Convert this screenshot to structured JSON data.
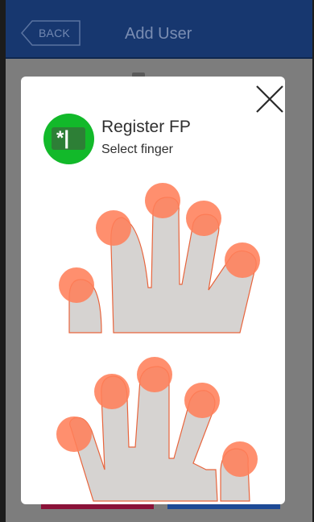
{
  "appbar": {
    "back_label": "BACK",
    "title": "Add User"
  },
  "dialog": {
    "title": "Register FP",
    "subtitle": "Select finger",
    "badge_glyph": "*|",
    "close_icon": "close-icon",
    "badge_icon": "fingerprint-register-icon"
  },
  "colors": {
    "appbar": "#17376f",
    "badge": "#12b92a",
    "finger_marker": "#ff7f5a",
    "hand_fill": "#d6d3d1",
    "hand_outline": "#e8643c"
  },
  "fingers": {
    "upper_hand": [
      "thumb",
      "index",
      "middle",
      "ring",
      "little"
    ],
    "lower_hand": [
      "thumb",
      "index",
      "middle",
      "ring",
      "little"
    ]
  }
}
